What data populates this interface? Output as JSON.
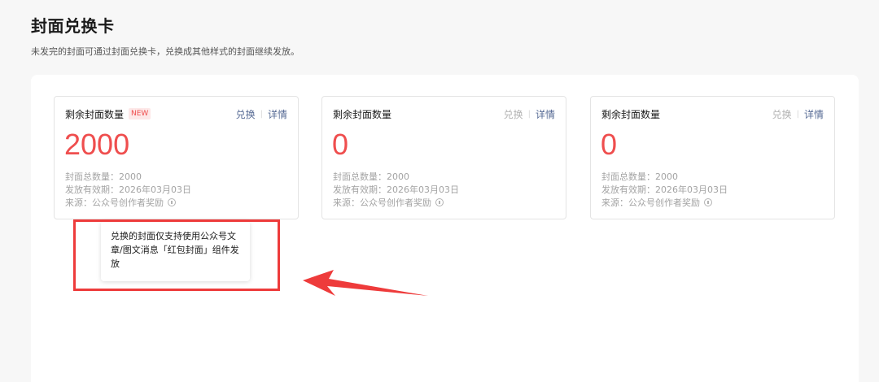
{
  "page": {
    "title": "封面兑换卡",
    "description": "未发完的封面可通过封面兑换卡，兑换成其他样式的封面继续发放。"
  },
  "cards": [
    {
      "title": "剩余封面数量",
      "badge": "NEW",
      "exchange_label": "兑换",
      "exchange_enabled": true,
      "separator": "|",
      "detail_label": "详情",
      "count": "2000",
      "total": "封面总数量：2000",
      "valid": "发放有效期：2026年03月03日",
      "source": "来源：公众号创作者奖励"
    },
    {
      "title": "剩余封面数量",
      "exchange_label": "兑换",
      "exchange_enabled": false,
      "separator": "|",
      "detail_label": "详情",
      "count": "0",
      "total": "封面总数量：2000",
      "valid": "发放有效期：2026年03月03日",
      "source": "来源：公众号创作者奖励"
    },
    {
      "title": "剩余封面数量",
      "exchange_label": "兑换",
      "exchange_enabled": false,
      "separator": "|",
      "detail_label": "详情",
      "count": "0",
      "total": "封面总数量：2000",
      "valid": "发放有效期：2026年03月03日",
      "source": "来源：公众号创作者奖励"
    }
  ],
  "tooltip": {
    "text": "兑换的封面仅支持使用公众号文章/图文消息「红包封面」组件发放"
  },
  "colors": {
    "accent_red": "#ef4e4e",
    "link_blue": "#576b95",
    "annotation_red": "#ee3b3b"
  }
}
